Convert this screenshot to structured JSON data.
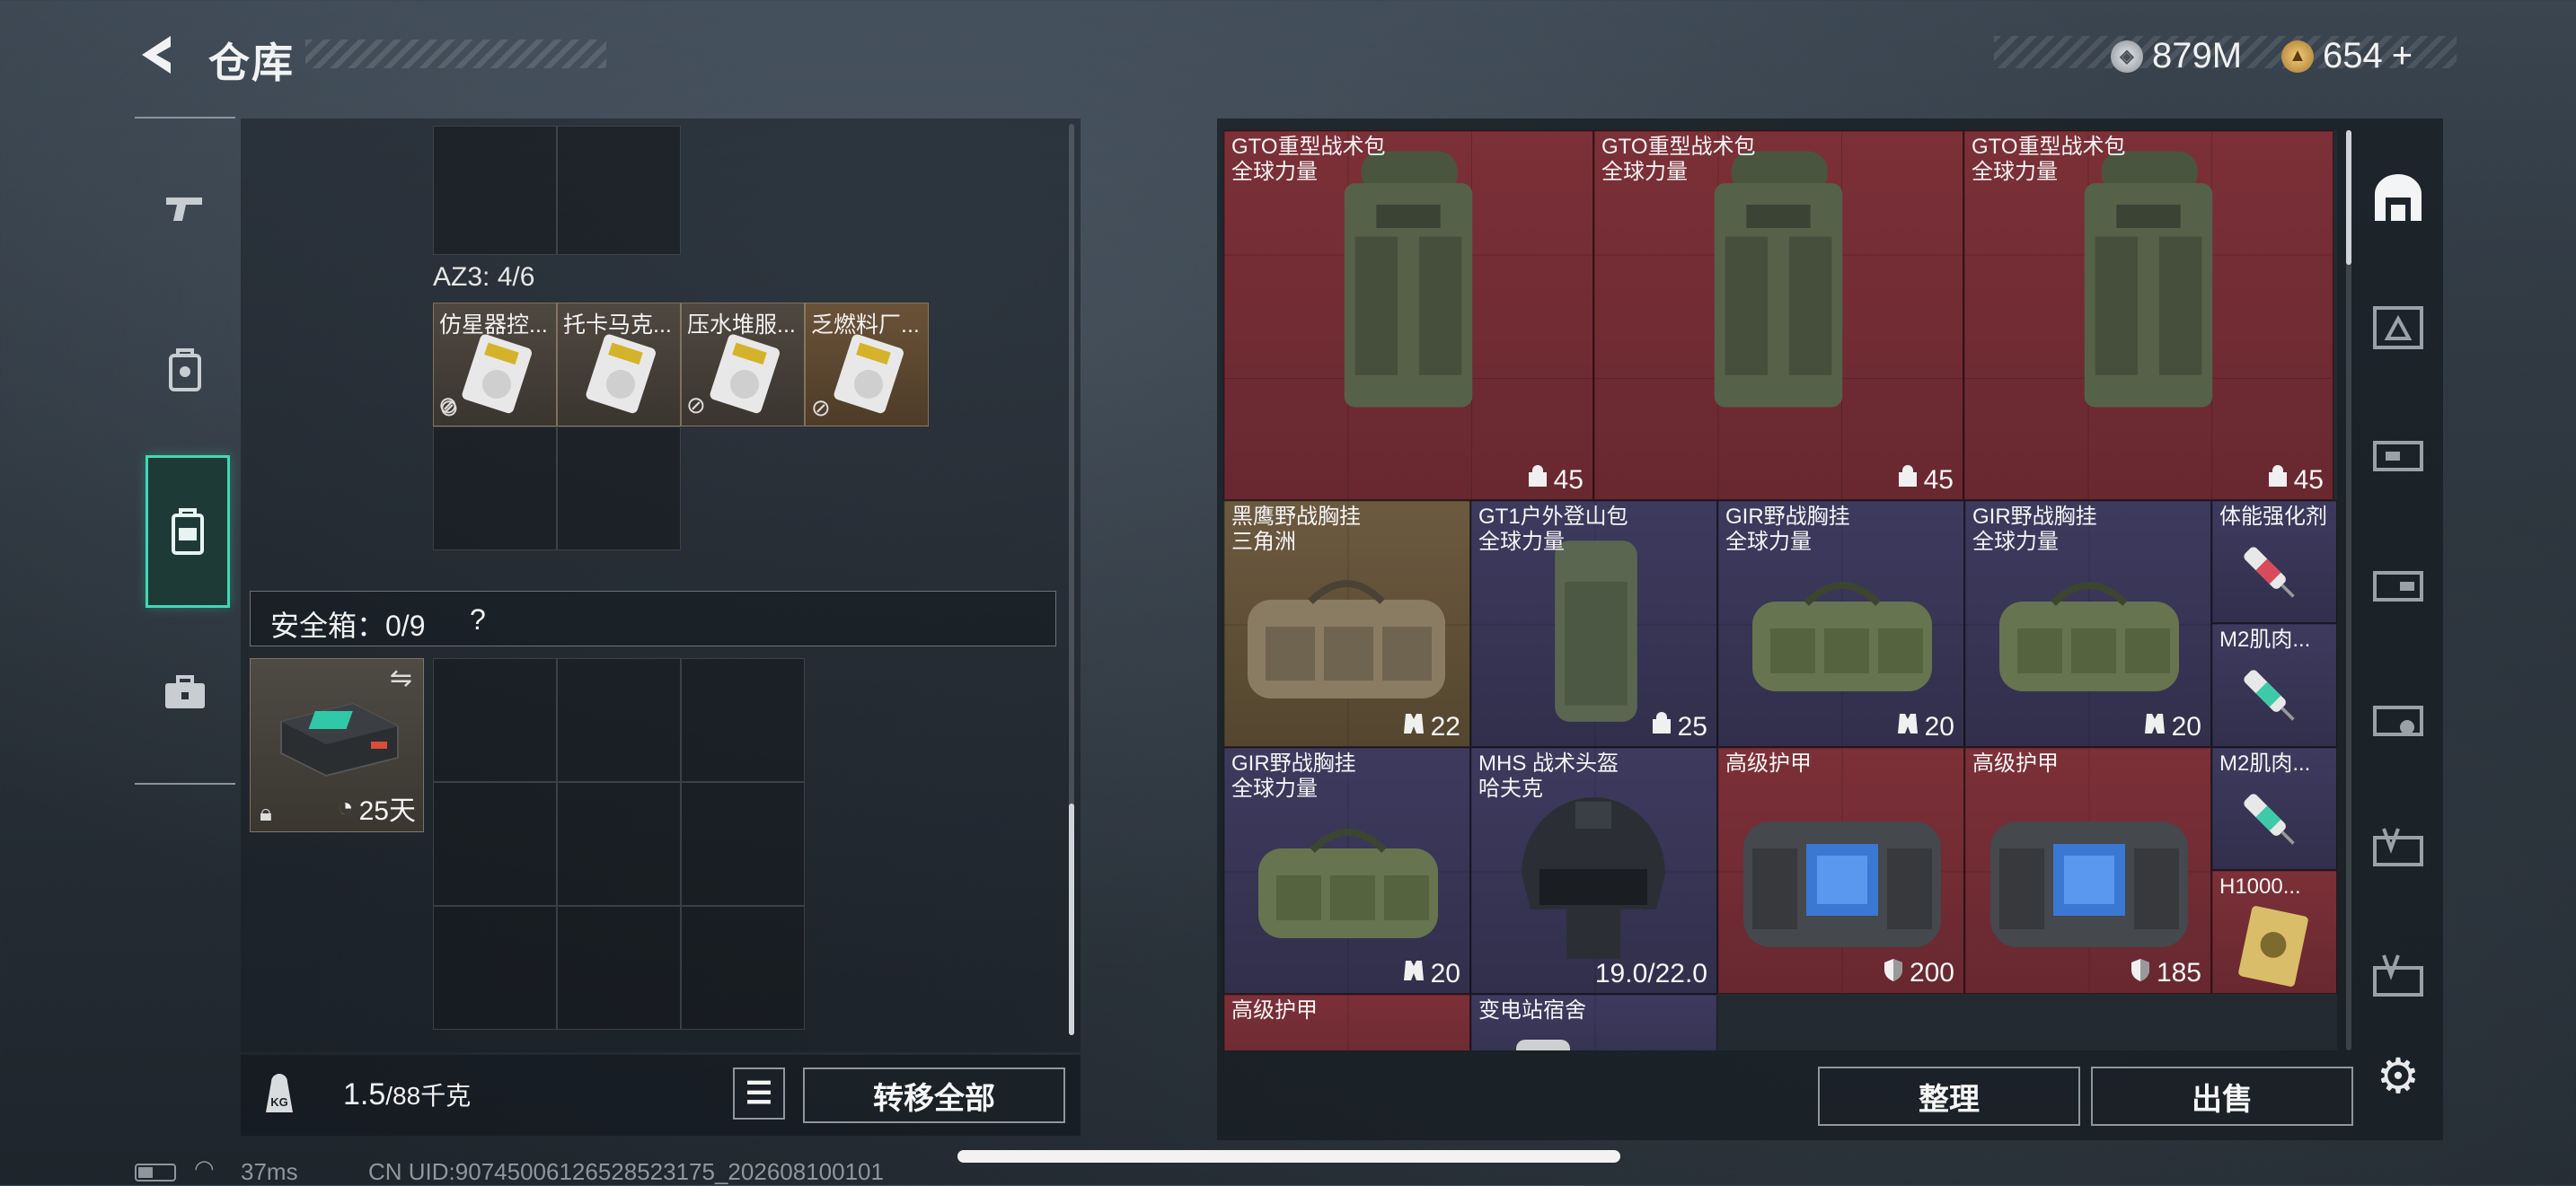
{
  "header": {
    "title": "仓库",
    "currency1": {
      "value": "879M",
      "icon": "silver-coin-icon",
      "color": "#c9ccd0"
    },
    "currency2": {
      "value": "654",
      "icon": "gold-coin-icon",
      "color": "#d8a857",
      "add_label": "+"
    }
  },
  "nav": [
    {
      "name": "nav-weapons",
      "icon": "pistol-icon"
    },
    {
      "name": "nav-equipment",
      "icon": "gear-bag-icon"
    },
    {
      "name": "nav-backpack",
      "icon": "backpack-icon",
      "active": true
    },
    {
      "name": "nav-cases",
      "icon": "toolbox-icon"
    }
  ],
  "loadout": {
    "az3_label": "AZ3: 4/6",
    "az3_items": [
      "仿星器控...",
      "托卡马克...",
      "压水堆服...",
      "乏燃料厂..."
    ],
    "safe_box_label": "安全箱：0/9",
    "safe_box_help": "?",
    "safe_box_item": {
      "duration": "25天"
    }
  },
  "footer_left": {
    "weight": "1.5",
    "weight_max": "/88千克",
    "kg_icon_label": "KG",
    "transfer_all": "转移全部"
  },
  "stash": [
    {
      "name": "GTO重型战术包",
      "sub": "全球力量",
      "badge": "45",
      "badge_icon": "capacity-icon",
      "color": "red"
    },
    {
      "name": "GTO重型战术包",
      "sub": "全球力量",
      "badge": "45",
      "badge_icon": "capacity-icon",
      "color": "red"
    },
    {
      "name": "GTO重型战术包",
      "sub": "全球力量",
      "badge": "45",
      "badge_icon": "capacity-icon",
      "color": "red"
    },
    {
      "name": "黑鹰野战胸挂",
      "sub": "三角洲",
      "badge": "22",
      "badge_icon": "vest-icon",
      "color": "gold"
    },
    {
      "name": "GT1户外登山包",
      "sub": "全球力量",
      "badge": "25",
      "badge_icon": "capacity-icon",
      "color": "purple"
    },
    {
      "name": "GIR野战胸挂",
      "sub": "全球力量",
      "badge": "20",
      "badge_icon": "vest-icon",
      "color": "purple"
    },
    {
      "name": "GIR野战胸挂",
      "sub": "全球力量",
      "badge": "20",
      "badge_icon": "vest-icon",
      "color": "purple"
    },
    {
      "name": "体能强化剂",
      "sub": "",
      "badge": "",
      "color": "purple"
    },
    {
      "name": "M2肌肉...",
      "sub": "",
      "badge": "",
      "color": "purple"
    },
    {
      "name": "GIR野战胸挂",
      "sub": "全球力量",
      "badge": "20",
      "badge_icon": "vest-icon",
      "color": "purple"
    },
    {
      "name": "MHS 战术头盔",
      "sub": "哈夫克",
      "badge": "19.0/22.0",
      "color": "purple"
    },
    {
      "name": "高级护甲",
      "sub": "",
      "badge": "200",
      "badge_icon": "shield-icon",
      "color": "red"
    },
    {
      "name": "高级护甲",
      "sub": "",
      "badge": "185",
      "badge_icon": "shield-icon",
      "color": "red"
    },
    {
      "name": "M2肌肉...",
      "sub": "",
      "badge": "",
      "color": "purple"
    },
    {
      "name": "H1000...",
      "sub": "",
      "badge": "",
      "color": "red"
    },
    {
      "name": "高级护甲",
      "sub": "",
      "badge": "",
      "color": "red"
    },
    {
      "name": "变电站宿舍",
      "sub": "",
      "badge": "",
      "color": "purple"
    }
  ],
  "footer_right": {
    "sort": "整理",
    "sell": "出售"
  },
  "status": {
    "ping": "37ms",
    "uid": "CN UID:9074500612652852317​5_202608100101"
  }
}
